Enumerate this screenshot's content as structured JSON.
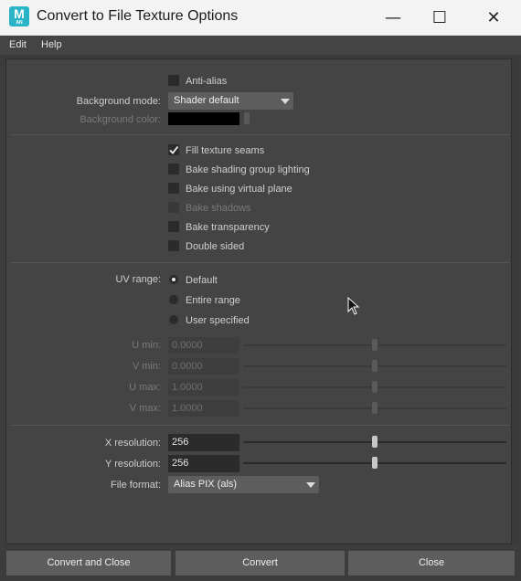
{
  "window": {
    "title": "Convert to File Texture Options",
    "app_icon_letter": "M",
    "app_icon_sub": "AN",
    "controls": {
      "minimize": "—",
      "maximize": "☐",
      "close": "✕"
    }
  },
  "menu": [
    "Edit",
    "Help"
  ],
  "options": {
    "anti_alias": {
      "label": "Anti-alias",
      "checked": false
    },
    "background_mode": {
      "label": "Background mode:",
      "value": "Shader default"
    },
    "background_color": {
      "label": "Background color:",
      "color": "#000000"
    },
    "fill_texture_seams": {
      "label": "Fill texture seams",
      "checked": true
    },
    "bake_shading_group_lighting": {
      "label": "Bake shading group lighting",
      "checked": false
    },
    "bake_using_virtual_plane": {
      "label": "Bake using virtual plane",
      "checked": false
    },
    "bake_shadows": {
      "label": "Bake shadows",
      "checked": false,
      "enabled": false
    },
    "bake_transparency": {
      "label": "Bake transparency",
      "checked": false
    },
    "double_sided": {
      "label": "Double sided",
      "checked": false
    }
  },
  "uv_range": {
    "label": "UV range:",
    "options": [
      "Default",
      "Entire range",
      "User specified"
    ],
    "selected": "Default"
  },
  "uv_fields": [
    {
      "label": "U min:",
      "value": "0.0000"
    },
    {
      "label": "V min:",
      "value": "0.0000"
    },
    {
      "label": "U max:",
      "value": "1.0000"
    },
    {
      "label": "V max:",
      "value": "1.0000"
    }
  ],
  "resolution": {
    "x": {
      "label": "X resolution:",
      "value": "256"
    },
    "y": {
      "label": "Y resolution:",
      "value": "256"
    }
  },
  "file_format": {
    "label": "File format:",
    "value": "Alias PIX (als)"
  },
  "buttons": {
    "convert_and_close": "Convert and Close",
    "convert": "Convert",
    "close": "Close"
  }
}
